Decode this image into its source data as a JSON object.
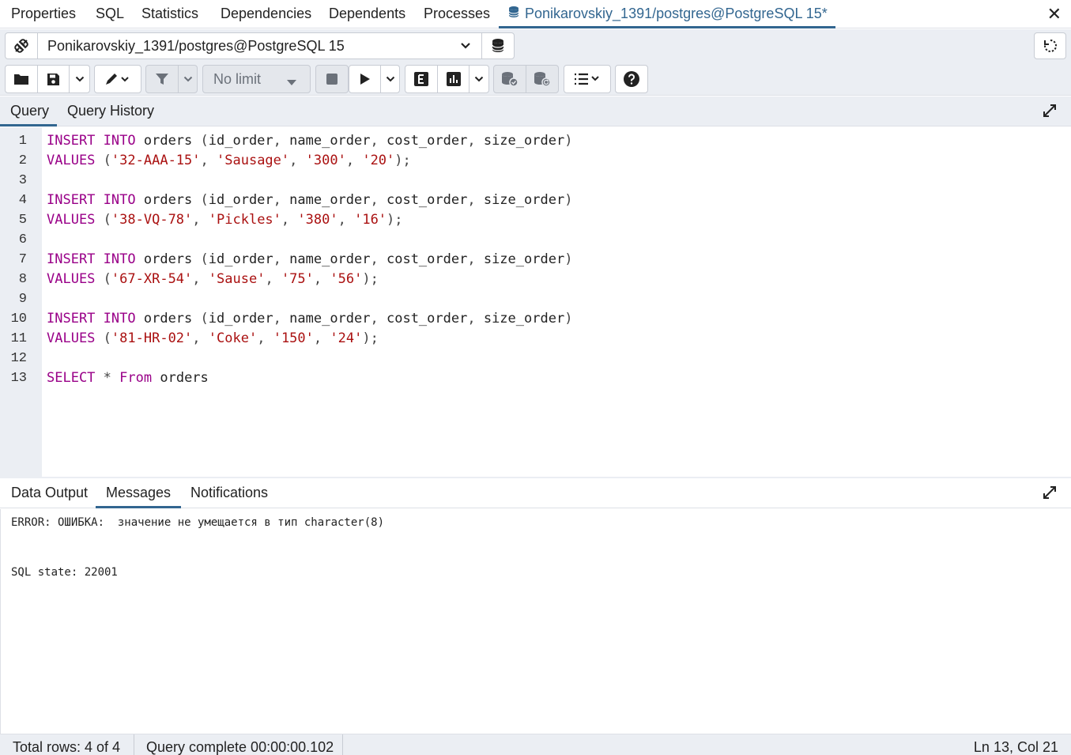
{
  "top_tabs": [
    {
      "label": "Properties"
    },
    {
      "label": "SQL"
    },
    {
      "label": "Statistics"
    },
    {
      "label": "Dependencies"
    },
    {
      "label": "Dependents"
    },
    {
      "label": "Processes"
    },
    {
      "label": "Ponikarovskiy_1391/postgres@PostgreSQL 15*"
    }
  ],
  "connection": {
    "name": "Ponikarovskiy_1391/postgres@PostgreSQL 15"
  },
  "toolbar": {
    "limit_label": "No limit"
  },
  "query_tabs": [
    {
      "label": "Query"
    },
    {
      "label": "Query History"
    }
  ],
  "editor": {
    "lines": [
      {
        "n": "1",
        "tokens": [
          [
            "kw",
            "INSERT"
          ],
          [
            "t",
            " "
          ],
          [
            "kw",
            "INTO"
          ],
          [
            "t",
            " orders "
          ],
          [
            "pn",
            "("
          ],
          [
            "t",
            "id_order"
          ],
          [
            "pn",
            ","
          ],
          [
            "t",
            " name_order"
          ],
          [
            "pn",
            ","
          ],
          [
            "t",
            " cost_order"
          ],
          [
            "pn",
            ","
          ],
          [
            "t",
            " size_order"
          ],
          [
            "pn",
            ")"
          ]
        ]
      },
      {
        "n": "2",
        "tokens": [
          [
            "kw",
            "VALUES"
          ],
          [
            "t",
            " "
          ],
          [
            "pn",
            "("
          ],
          [
            "str",
            "'32-AAA-15'"
          ],
          [
            "pn",
            ","
          ],
          [
            "t",
            " "
          ],
          [
            "str",
            "'Sausage'"
          ],
          [
            "pn",
            ","
          ],
          [
            "t",
            " "
          ],
          [
            "str",
            "'300'"
          ],
          [
            "pn",
            ","
          ],
          [
            "t",
            " "
          ],
          [
            "str",
            "'20'"
          ],
          [
            "pn",
            ");"
          ]
        ]
      },
      {
        "n": "3",
        "tokens": []
      },
      {
        "n": "4",
        "tokens": [
          [
            "kw",
            "INSERT"
          ],
          [
            "t",
            " "
          ],
          [
            "kw",
            "INTO"
          ],
          [
            "t",
            " orders "
          ],
          [
            "pn",
            "("
          ],
          [
            "t",
            "id_order"
          ],
          [
            "pn",
            ","
          ],
          [
            "t",
            " name_order"
          ],
          [
            "pn",
            ","
          ],
          [
            "t",
            " cost_order"
          ],
          [
            "pn",
            ","
          ],
          [
            "t",
            " size_order"
          ],
          [
            "pn",
            ")"
          ]
        ]
      },
      {
        "n": "5",
        "tokens": [
          [
            "kw",
            "VALUES"
          ],
          [
            "t",
            " "
          ],
          [
            "pn",
            "("
          ],
          [
            "str",
            "'38-VQ-78'"
          ],
          [
            "pn",
            ","
          ],
          [
            "t",
            " "
          ],
          [
            "str",
            "'Pickles'"
          ],
          [
            "pn",
            ","
          ],
          [
            "t",
            " "
          ],
          [
            "str",
            "'380'"
          ],
          [
            "pn",
            ","
          ],
          [
            "t",
            " "
          ],
          [
            "str",
            "'16'"
          ],
          [
            "pn",
            ");"
          ]
        ]
      },
      {
        "n": "6",
        "tokens": []
      },
      {
        "n": "7",
        "tokens": [
          [
            "kw",
            "INSERT"
          ],
          [
            "t",
            " "
          ],
          [
            "kw",
            "INTO"
          ],
          [
            "t",
            " orders "
          ],
          [
            "pn",
            "("
          ],
          [
            "t",
            "id_order"
          ],
          [
            "pn",
            ","
          ],
          [
            "t",
            " name_order"
          ],
          [
            "pn",
            ","
          ],
          [
            "t",
            " cost_order"
          ],
          [
            "pn",
            ","
          ],
          [
            "t",
            " size_order"
          ],
          [
            "pn",
            ")"
          ]
        ]
      },
      {
        "n": "8",
        "tokens": [
          [
            "kw",
            "VALUES"
          ],
          [
            "t",
            " "
          ],
          [
            "pn",
            "("
          ],
          [
            "str",
            "'67-XR-54'"
          ],
          [
            "pn",
            ","
          ],
          [
            "t",
            " "
          ],
          [
            "str",
            "'Sause'"
          ],
          [
            "pn",
            ","
          ],
          [
            "t",
            " "
          ],
          [
            "str",
            "'75'"
          ],
          [
            "pn",
            ","
          ],
          [
            "t",
            " "
          ],
          [
            "str",
            "'56'"
          ],
          [
            "pn",
            ");"
          ]
        ]
      },
      {
        "n": "9",
        "tokens": []
      },
      {
        "n": "10",
        "tokens": [
          [
            "kw",
            "INSERT"
          ],
          [
            "t",
            " "
          ],
          [
            "kw",
            "INTO"
          ],
          [
            "t",
            " orders "
          ],
          [
            "pn",
            "("
          ],
          [
            "t",
            "id_order"
          ],
          [
            "pn",
            ","
          ],
          [
            "t",
            " name_order"
          ],
          [
            "pn",
            ","
          ],
          [
            "t",
            " cost_order"
          ],
          [
            "pn",
            ","
          ],
          [
            "t",
            " size_order"
          ],
          [
            "pn",
            ")"
          ]
        ]
      },
      {
        "n": "11",
        "tokens": [
          [
            "kw",
            "VALUES"
          ],
          [
            "t",
            " "
          ],
          [
            "pn",
            "("
          ],
          [
            "str",
            "'81-HR-02'"
          ],
          [
            "pn",
            ","
          ],
          [
            "t",
            " "
          ],
          [
            "str",
            "'Coke'"
          ],
          [
            "pn",
            ","
          ],
          [
            "t",
            " "
          ],
          [
            "str",
            "'150'"
          ],
          [
            "pn",
            ","
          ],
          [
            "t",
            " "
          ],
          [
            "str",
            "'24'"
          ],
          [
            "pn",
            ");"
          ]
        ]
      },
      {
        "n": "12",
        "tokens": []
      },
      {
        "n": "13",
        "tokens": [
          [
            "kw",
            "SELECT"
          ],
          [
            "t",
            " "
          ],
          [
            "pn",
            "*"
          ],
          [
            "t",
            " "
          ],
          [
            "kw",
            "From"
          ],
          [
            "t",
            " orders"
          ]
        ]
      }
    ]
  },
  "output_tabs": [
    {
      "label": "Data Output"
    },
    {
      "label": "Messages"
    },
    {
      "label": "Notifications"
    }
  ],
  "messages": {
    "error_line": "ERROR: ОШИБКА:  значение не умещается в тип character(8)",
    "state_line": "SQL state: 22001"
  },
  "status": {
    "total_rows": "Total rows: 4 of 4",
    "query_complete": "Query complete 00:00:00.102",
    "cursor": "Ln 13, Col 21"
  },
  "colors": {
    "accent": "#326690",
    "keyword": "#990088",
    "string": "#aa1111",
    "panel_bg": "#ebeef3"
  }
}
